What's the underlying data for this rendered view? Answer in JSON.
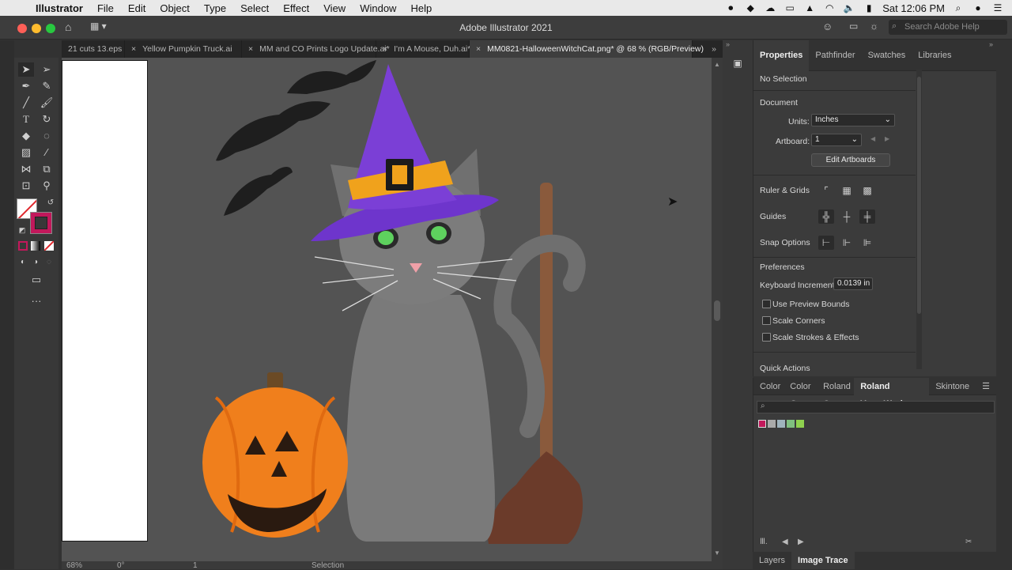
{
  "menubar": {
    "app_name": "Illustrator",
    "items": [
      "File",
      "Edit",
      "Object",
      "Type",
      "Select",
      "Effect",
      "View",
      "Window",
      "Help"
    ],
    "clock": "Sat 12:06 PM"
  },
  "titlebar": {
    "title": "Adobe Illustrator 2021",
    "search_placeholder": "Search Adobe Help"
  },
  "tabs": [
    {
      "label": "21 cuts 13.eps",
      "active": false,
      "close": ""
    },
    {
      "label": "Yellow Pumpkin Truck.ai",
      "active": false,
      "close": "×"
    },
    {
      "label": "MM and CO Prints Logo Update.ai*",
      "active": false,
      "close": "×"
    },
    {
      "label": "I'm A Mouse, Duh.ai*",
      "active": false,
      "close": "×"
    },
    {
      "label": "MM0821-HalloweenWitchCat.png* @ 68 % (RGB/Preview)",
      "active": true,
      "close": "×"
    }
  ],
  "properties_panel": {
    "tabs": [
      "Properties",
      "Pathfinder",
      "Swatches",
      "Libraries"
    ],
    "selection": "No Selection",
    "document_heading": "Document",
    "units_label": "Units:",
    "units_value": "Inches",
    "artboard_label": "Artboard:",
    "artboard_value": "1",
    "edit_artboards": "Edit Artboards",
    "ruler_grids": "Ruler & Grids",
    "guides": "Guides",
    "snap_options": "Snap Options",
    "preferences": "Preferences",
    "keyboard_increment_label": "Keyboard Increment:",
    "keyboard_increment_value": "0.0139 in",
    "use_preview_bounds": "Use Preview Bounds",
    "scale_corners": "Scale Corners",
    "scale_strokes": "Scale Strokes & Effects",
    "quick_actions": "Quick Actions"
  },
  "color_panel": {
    "tabs": [
      "Color",
      "Color Gu",
      "Roland C",
      "Roland VersaWorks",
      "Skintone"
    ],
    "active_tab": "Roland VersaWorks"
  },
  "bottom_tabs": [
    "Layers",
    "Image Trace"
  ],
  "statusbar": {
    "zoom": "68%",
    "rotation": "0°",
    "artboard": "1",
    "tool": "Selection"
  },
  "colors": {
    "canvas": "#535353",
    "stroke_swatch": "#c2185b",
    "hat": "#7b3fd6",
    "pumpkin": "#f07f1c"
  }
}
